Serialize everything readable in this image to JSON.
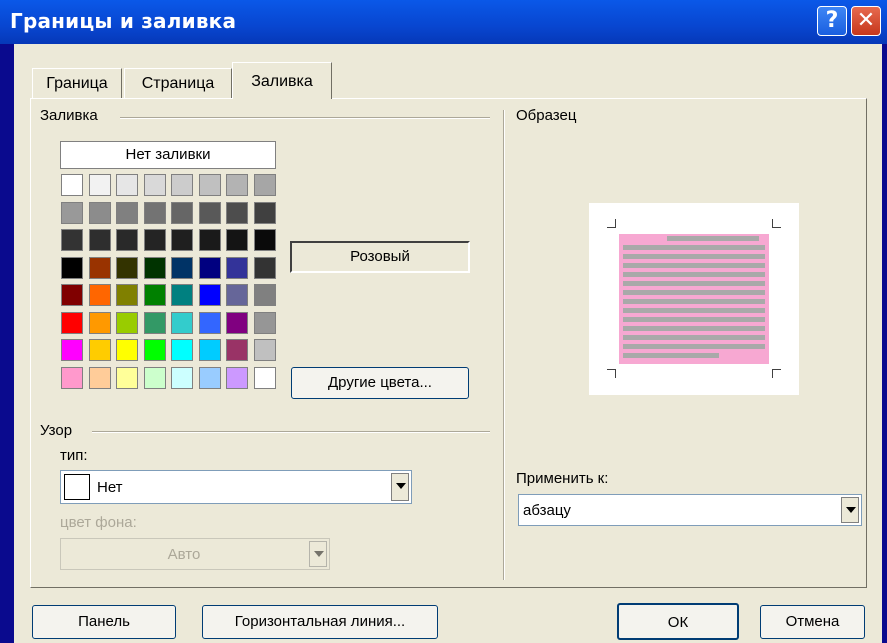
{
  "window": {
    "title": "Границы и заливка",
    "help_label": "?",
    "close_label": "✕"
  },
  "tabs": [
    {
      "label": "Граница",
      "active": false
    },
    {
      "label": "Страница",
      "active": false
    },
    {
      "label": "Заливка",
      "active": true
    }
  ],
  "fill": {
    "section_label": "Заливка",
    "no_fill_label": "Нет заливки",
    "selected_color_name": "Розовый",
    "more_colors_label": "Другие цвета...",
    "selected_color": "#f7a8d2",
    "palette": [
      [
        "#ffffff",
        "#f2f2f2",
        "#e6e6e6",
        "#d9d9d9",
        "#cccccc",
        "#c0c0c0",
        "#b3b3b3",
        "#a6a6a6"
      ],
      [
        "#999999",
        "#8c8c8c",
        "#808080",
        "#737373",
        "#666666",
        "#595959",
        "#4d4d4d",
        "#404040"
      ],
      [
        "#333333",
        "#2e2e2e",
        "#292929",
        "#242424",
        "#1f1f1f",
        "#1a1a1a",
        "#141414",
        "#0a0a0a"
      ],
      [
        "#000000",
        "#993300",
        "#333300",
        "#003300",
        "#003366",
        "#000080",
        "#333399",
        "#333333"
      ],
      [
        "#800000",
        "#ff6600",
        "#808000",
        "#008000",
        "#008080",
        "#0000ff",
        "#666699",
        "#808080"
      ],
      [
        "#ff0000",
        "#ff9900",
        "#99cc00",
        "#339966",
        "#33cccc",
        "#3366ff",
        "#800080",
        "#969696"
      ],
      [
        "#ff00ff",
        "#ffcc00",
        "#ffff00",
        "#00ff00",
        "#00ffff",
        "#00ccff",
        "#993366",
        "#c0c0c0"
      ],
      [
        "#ff99cc",
        "#ffcc99",
        "#ffff99",
        "#ccffcc",
        "#ccffff",
        "#99ccff",
        "#cc99ff",
        "#ffffff"
      ]
    ]
  },
  "pattern": {
    "section_label": "Узор",
    "type_label": "тип:",
    "type_value": "Нет",
    "bg_color_label": "цвет фона:",
    "bg_color_value": "Авто"
  },
  "preview": {
    "section_label": "Образец",
    "apply_to_label": "Применить к:",
    "apply_to_value": "абзацу"
  },
  "footer": {
    "panel_label": "Панель",
    "hline_label": "Горизонтальная линия...",
    "ok_label": "ОК",
    "cancel_label": "Отмена"
  }
}
